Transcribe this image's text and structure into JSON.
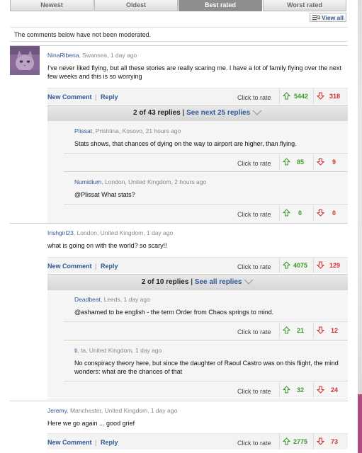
{
  "tabs": [
    "Newest",
    "Oldest",
    "Best rated",
    "Worst rated"
  ],
  "active_tab": "Best rated",
  "view_all": "View all",
  "notice": "The comments below have not been moderated.",
  "labels": {
    "new_comment": "New Comment",
    "reply": "Reply",
    "separator": "|",
    "click_to_rate": "Click to rate"
  },
  "comments": [
    {
      "author": "NinaRibena",
      "location": ", Swansea, 1 day ago",
      "text": "I've never liked flying, but all these stories are really scaring me. I have a lot of family flying over the next few weeks and this is so worrying",
      "up": "5442",
      "down": "318",
      "replies_count": "2 of 43 replies",
      "replies_link": "See next 25 replies",
      "replies": [
        {
          "author": "Plissat",
          "location": ", Prishtina, Kosovo, 21 hours ago",
          "text": "Stats shows, that chances of dying on the way to airport are higher, than flying.",
          "up": "85",
          "down": "9"
        },
        {
          "author": "Numidium",
          "location": ", London, United Kingdom, 2 hours ago",
          "text": "@Plissat What stats?",
          "up": "0",
          "down": "0"
        }
      ]
    },
    {
      "author": "Irishgirl23",
      "location": ", London, United Kingdom, 1 day ago",
      "text": "what is going on with the world? so scary!!",
      "up": "4075",
      "down": "129",
      "replies_count": "2 of 10 replies",
      "replies_link": "See all replies",
      "replies": [
        {
          "author": "Deadbeat",
          "location": ", Leeds, 1 day ago",
          "text": "@ashamed to be english - the term Order from Chaos springs to mind.",
          "up": "21",
          "down": "12"
        },
        {
          "author": "ti",
          "location": ", ta, United Kingdom, 1 day ago",
          "text": "No conspiracy theory here, but since the daughter of Raoul Castro was on this flight, the mind wonders: what are the chances of that",
          "up": "32",
          "down": "24"
        }
      ]
    },
    {
      "author": "Jeremy",
      "location": ", Manchester, United Kingdom, 1 day ago",
      "text": "Here we go again ... good grief",
      "up": "2775",
      "down": "73"
    }
  ],
  "colors": {
    "up": "#3a9a2a",
    "down": "#d23030",
    "link": "#2f5899",
    "scrollbar_accent": "#b04b7d"
  },
  "icons": [
    "view-all-icon",
    "avatar-cat",
    "thumb-up-arrow-icon",
    "thumb-down-arrow-icon",
    "chevron-down-icon"
  ]
}
